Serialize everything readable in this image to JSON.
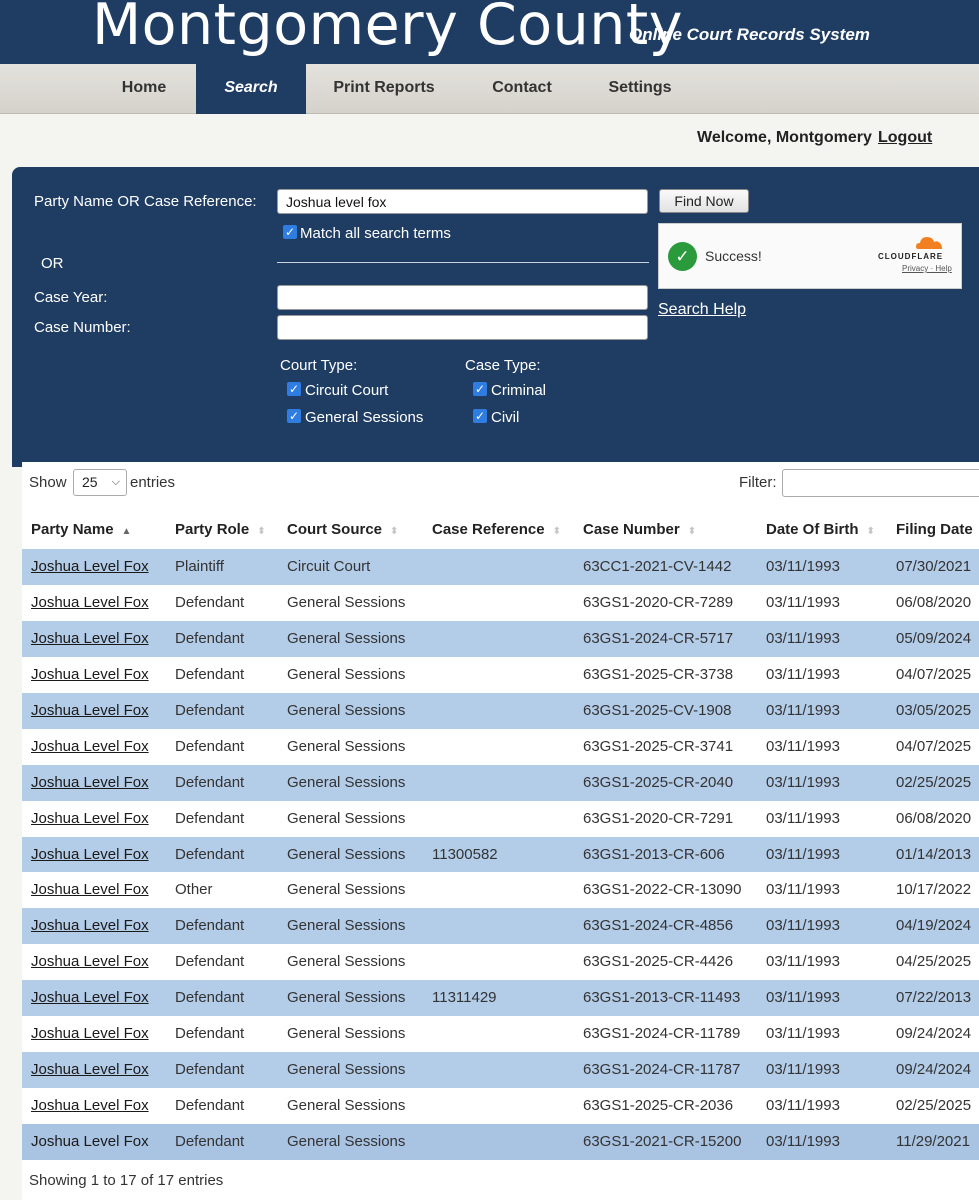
{
  "header": {
    "title": "Montgomery County",
    "subtitle": "Online Court Records System"
  },
  "nav": {
    "items": [
      {
        "label": "Home"
      },
      {
        "label": "Search",
        "active": true
      },
      {
        "label": "Print Reports"
      },
      {
        "label": "Contact"
      },
      {
        "label": "Settings"
      }
    ]
  },
  "user": {
    "welcome": "Welcome, Montgomery",
    "logout": "Logout"
  },
  "search": {
    "party_label": "Party Name OR Case Reference:",
    "party_value": "Joshua level fox",
    "find_button": "Find Now",
    "match_all_label": "Match all search terms",
    "match_all_checked": true,
    "or_label": "OR",
    "case_year_label": "Case Year:",
    "case_year_value": "",
    "case_number_label": "Case Number:",
    "case_number_value": "",
    "help_link": "Search Help",
    "court_type_label": "Court Type:",
    "court_types": [
      {
        "label": "Circuit Court",
        "checked": true
      },
      {
        "label": "General Sessions",
        "checked": true
      }
    ],
    "case_type_label": "Case Type:",
    "case_types": [
      {
        "label": "Criminal",
        "checked": true
      },
      {
        "label": "Civil",
        "checked": true
      }
    ]
  },
  "captcha": {
    "message": "Success!",
    "brand": "CLOUDFLARE",
    "links": "Privacy · Help"
  },
  "table": {
    "show_label": "Show",
    "page_size": "25",
    "entries_label": "entries",
    "filter_label": "Filter:",
    "filter_value": "",
    "columns": [
      "Party Name",
      "Party Role",
      "Court Source",
      "Case Reference",
      "Case Number",
      "Date Of Birth",
      "Filing Date"
    ],
    "sorted_column": "Party Name",
    "rows": [
      [
        "Joshua Level Fox",
        "Plaintiff",
        "Circuit Court",
        "",
        "63CC1-2021-CV-1442",
        "03/11/1993",
        "07/30/2021"
      ],
      [
        "Joshua Level Fox",
        "Defendant",
        "General Sessions",
        "",
        "63GS1-2020-CR-7289",
        "03/11/1993",
        "06/08/2020"
      ],
      [
        "Joshua Level Fox",
        "Defendant",
        "General Sessions",
        "",
        "63GS1-2024-CR-5717",
        "03/11/1993",
        "05/09/2024"
      ],
      [
        "Joshua Level Fox",
        "Defendant",
        "General Sessions",
        "",
        "63GS1-2025-CR-3738",
        "03/11/1993",
        "04/07/2025"
      ],
      [
        "Joshua Level Fox",
        "Defendant",
        "General Sessions",
        "",
        "63GS1-2025-CV-1908",
        "03/11/1993",
        "03/05/2025"
      ],
      [
        "Joshua Level Fox",
        "Defendant",
        "General Sessions",
        "",
        "63GS1-2025-CR-3741",
        "03/11/1993",
        "04/07/2025"
      ],
      [
        "Joshua Level Fox",
        "Defendant",
        "General Sessions",
        "",
        "63GS1-2025-CR-2040",
        "03/11/1993",
        "02/25/2025"
      ],
      [
        "Joshua Level Fox",
        "Defendant",
        "General Sessions",
        "",
        "63GS1-2020-CR-7291",
        "03/11/1993",
        "06/08/2020"
      ],
      [
        "Joshua Level Fox",
        "Defendant",
        "General Sessions",
        "11300582",
        "63GS1-2013-CR-606",
        "03/11/1993",
        "01/14/2013"
      ],
      [
        "Joshua Level Fox",
        "Other",
        "General Sessions",
        "",
        "63GS1-2022-CR-13090",
        "03/11/1993",
        "10/17/2022"
      ],
      [
        "Joshua Level Fox",
        "Defendant",
        "General Sessions",
        "",
        "63GS1-2024-CR-4856",
        "03/11/1993",
        "04/19/2024"
      ],
      [
        "Joshua Level Fox",
        "Defendant",
        "General Sessions",
        "",
        "63GS1-2025-CR-4426",
        "03/11/1993",
        "04/25/2025"
      ],
      [
        "Joshua Level Fox",
        "Defendant",
        "General Sessions",
        "11311429",
        "63GS1-2013-CR-11493",
        "03/11/1993",
        "07/22/2013"
      ],
      [
        "Joshua Level Fox",
        "Defendant",
        "General Sessions",
        "",
        "63GS1-2024-CR-11789",
        "03/11/1993",
        "09/24/2024"
      ],
      [
        "Joshua Level Fox",
        "Defendant",
        "General Sessions",
        "",
        "63GS1-2024-CR-11787",
        "03/11/1993",
        "09/24/2024"
      ],
      [
        "Joshua Level Fox",
        "Defendant",
        "General Sessions",
        "",
        "63GS1-2025-CR-2036",
        "03/11/1993",
        "02/25/2025"
      ],
      [
        "Joshua Level Fox",
        "Defendant",
        "General Sessions",
        "",
        "63GS1-2021-CR-15200",
        "03/11/1993",
        "11/29/2021"
      ]
    ],
    "summary": "Showing 1 to 17 of 17 entries"
  },
  "colors": {
    "brand_navy": "#1f3d63",
    "row_highlight": "#b3cce8",
    "checkbox_blue": "#2f7de1",
    "success_green": "#2a9a3d",
    "cloudflare_orange": "#f38020"
  }
}
